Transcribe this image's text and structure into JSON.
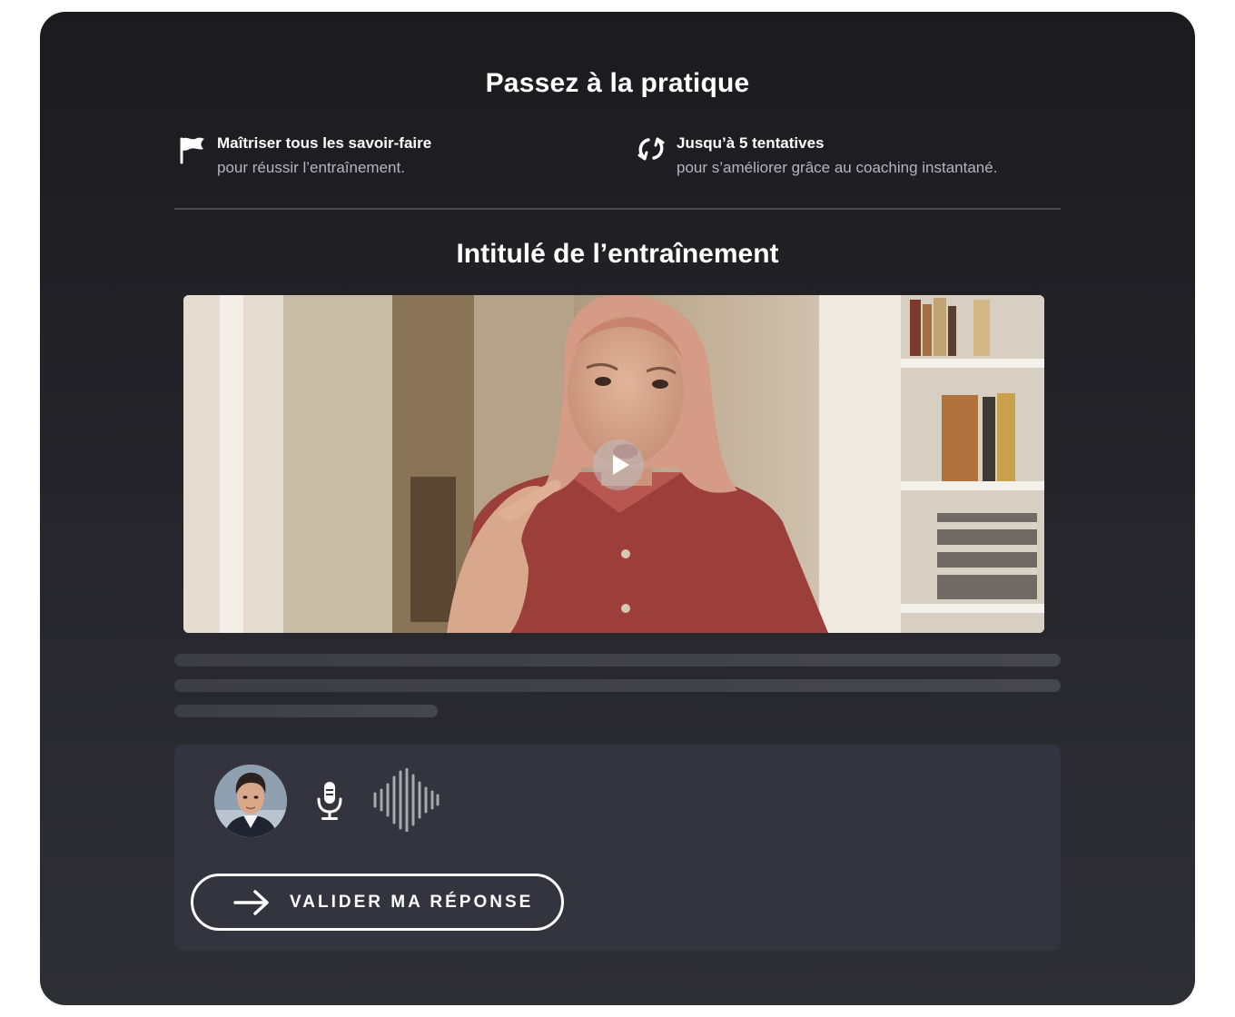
{
  "header": {
    "title": "Passez à la pratique"
  },
  "features": [
    {
      "icon": "flag-icon",
      "title": "Maîtriser tous les savoir-faire",
      "description": "pour réussir l’entraînement."
    },
    {
      "icon": "refresh-icon",
      "title": "Jusqu’à 5 tentatives",
      "description": "pour s’améliorer grâce au coaching instantané."
    }
  ],
  "exercise": {
    "title": "Intitulé de l’entraînement"
  },
  "video": {
    "play_icon": "play-icon"
  },
  "answer": {
    "avatar_icon": "user-avatar",
    "mic_icon": "microphone-icon",
    "wave_icon": "audio-waveform-icon",
    "validate_label": "VALIDER MA RÉPONSE"
  },
  "colors": {
    "background": "#1e1e23",
    "panel": "#34343e",
    "text": "#ffffff",
    "muted": "#b4b4bb"
  }
}
